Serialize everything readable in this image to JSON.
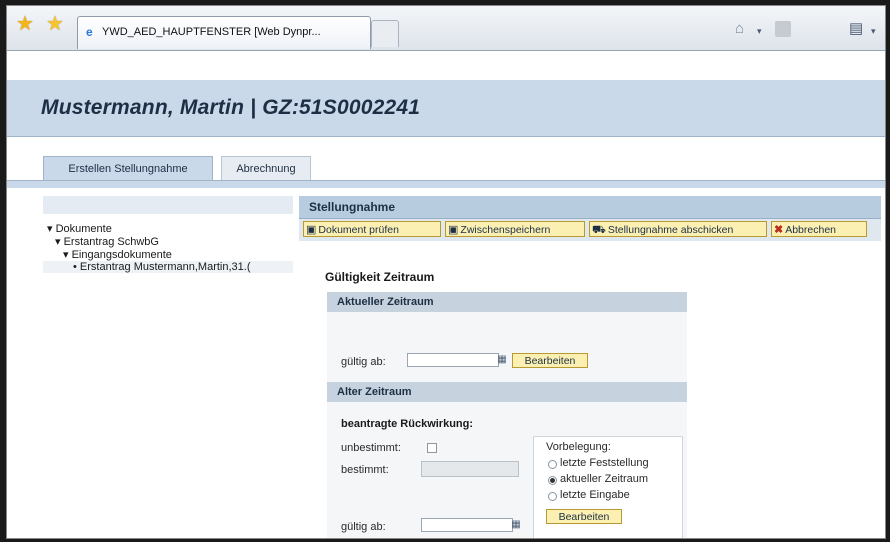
{
  "browser": {
    "tab_title": "YWD_AED_HAUPTFENSTER [Web Dynpr...",
    "icons": [
      "favorites-star-icon",
      "add-favorite-icon",
      "ie-page-icon",
      "home-icon",
      "rss-feed-icon",
      "print-icon"
    ]
  },
  "header": {
    "title": "Mustermann, Martin | GZ:51S0002241"
  },
  "main_tabs": [
    {
      "label": "Erstellen Stellungnahme",
      "active": true
    },
    {
      "label": "Abrechnung",
      "active": false
    }
  ],
  "tree": {
    "items": [
      {
        "label": "Dokumente",
        "marker": "▾"
      },
      {
        "label": "Erstantrag SchwbG",
        "marker": "▾"
      },
      {
        "label": "Eingangsdokumente",
        "marker": "▾"
      },
      {
        "label": "Erstantrag Mustermann,Martin,31.(",
        "marker": "•"
      }
    ]
  },
  "panel": {
    "title": "Stellungnahme",
    "buttons": {
      "pruefen": "Dokument prüfen",
      "speichern": "Zwischenspeichern",
      "abschicken": "Stellungnahme abschicken",
      "abbrechen": "Abbrechen"
    },
    "section_title": "Gültigkeit Zeitraum",
    "current": {
      "header": "Aktueller Zeitraum",
      "gueltig_label": "gültig ab:",
      "gueltig_value": "",
      "edit_button": "Bearbeiten"
    },
    "old": {
      "header": "Alter Zeitraum",
      "subheader": "beantragte Rückwirkung:",
      "unbestimmt_label": "unbestimmt:",
      "unbestimmt_checked": false,
      "bestimmt_label": "bestimmt:",
      "bestimmt_value": "",
      "gueltig_label": "gültig ab:",
      "gueltig_value": "",
      "vorbelegung_label": "Vorbelegung:",
      "radios": [
        {
          "label": "letzte Feststellung",
          "selected": false
        },
        {
          "label": "aktueller Zeitraum",
          "selected": true
        },
        {
          "label": "letzte Eingabe",
          "selected": false
        }
      ],
      "edit_button": "Bearbeiten"
    }
  },
  "colors": {
    "header_bg": "#c9d9ea",
    "button_yellow": "#fbf0b2",
    "group_header": "#c6d2dd"
  }
}
